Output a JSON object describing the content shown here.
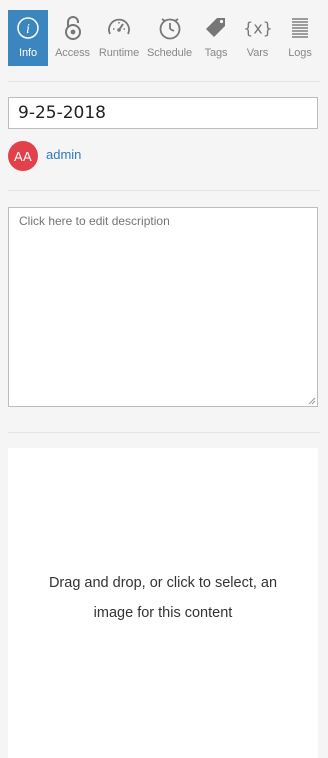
{
  "tabs": [
    {
      "id": "info",
      "label": "Info",
      "icon": "info-icon",
      "active": true
    },
    {
      "id": "access",
      "label": "Access",
      "icon": "lock-icon",
      "active": false
    },
    {
      "id": "runtime",
      "label": "Runtime",
      "icon": "gauge-icon",
      "active": false
    },
    {
      "id": "schedule",
      "label": "Schedule",
      "icon": "clock-icon",
      "active": false
    },
    {
      "id": "tags",
      "label": "Tags",
      "icon": "tag-icon",
      "active": false
    },
    {
      "id": "vars",
      "label": "Vars",
      "icon": "braces-x-icon",
      "active": false
    },
    {
      "id": "logs",
      "label": "Logs",
      "icon": "log-lines-icon",
      "active": false
    }
  ],
  "content": {
    "title": "9-25-2018",
    "owner": {
      "initials": "AA",
      "name": "admin"
    },
    "description_placeholder": "Click here to edit description",
    "dropzone_text": "Drag and drop, or click to select, an image for this content"
  },
  "colors": {
    "active_tab": "#3b86bf",
    "avatar": "#e2404b",
    "link": "#2f7bbf",
    "background": "#f5f5f5"
  }
}
